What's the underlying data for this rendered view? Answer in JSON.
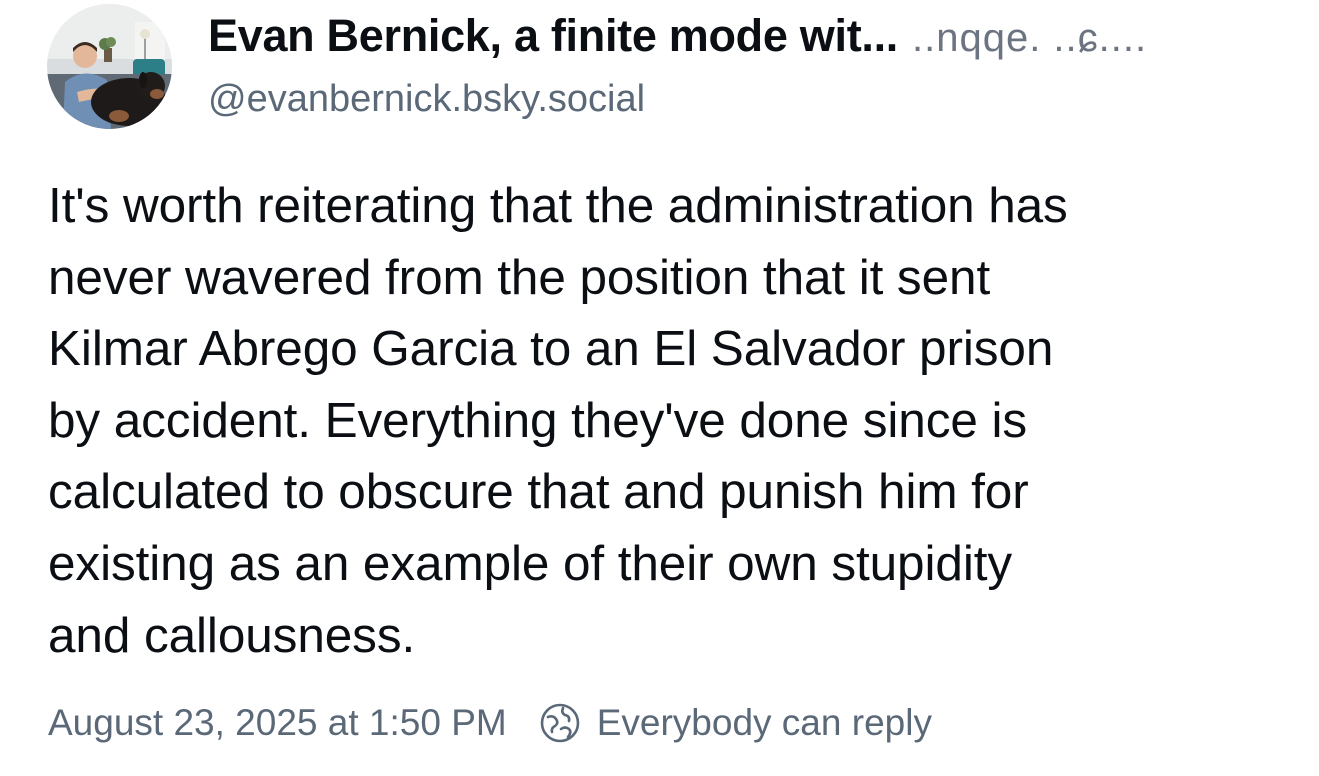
{
  "post": {
    "author": {
      "display_name": "Evan Bernick, a finite mode wit...",
      "display_name_tail": "..nqqe. ..ɕ....",
      "handle": "@evanbernick.bsky.social",
      "avatar_icon": "profile-photo-person-with-dog"
    },
    "text_lines": [
      "It's worth reiterating that the administration has",
      "never wavered from the position that it sent",
      "Kilmar Abrego Garcia to an El Salvador prison",
      "by accident. Everything they've done since is",
      "calculated to obscure that and punish him for",
      "existing as an example of their own stupidity",
      "and callousness."
    ],
    "timestamp": "August 23, 2025 at 1:50 PM",
    "reply_setting": "Everybody can reply",
    "reply_setting_icon": "globe-icon"
  },
  "colors": {
    "text": "#0b0f14",
    "muted": "#5a6878",
    "background": "#ffffff"
  }
}
